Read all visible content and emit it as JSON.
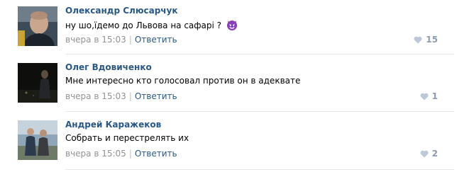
{
  "comments": [
    {
      "author": "Олександр Слюсарчук",
      "text": "ну шо,їдемо до Львова на сафарі ?",
      "emoji": "smiling-imp-emoji",
      "time": "вчера в 15:03",
      "reply_label": "Ответить",
      "likes": "15"
    },
    {
      "author": "Олег Вдовиченко",
      "text": "Мне интересно кто голосовал против он в адеквате",
      "time": "вчера в 15:03",
      "reply_label": "Ответить",
      "likes": "1"
    },
    {
      "author": "Андрей Каражеков",
      "text": "Собрать и перестрелять их",
      "time": "вчера в 15:05",
      "reply_label": "Ответить",
      "likes": "2"
    }
  ],
  "colors": {
    "link": "#2a5885",
    "meta": "#939393",
    "likes": "#8a9bb0",
    "divider": "#e7e8ec",
    "emoji": "#8a3fb5"
  },
  "icons": {
    "like": "heart-icon",
    "separator": "|"
  }
}
